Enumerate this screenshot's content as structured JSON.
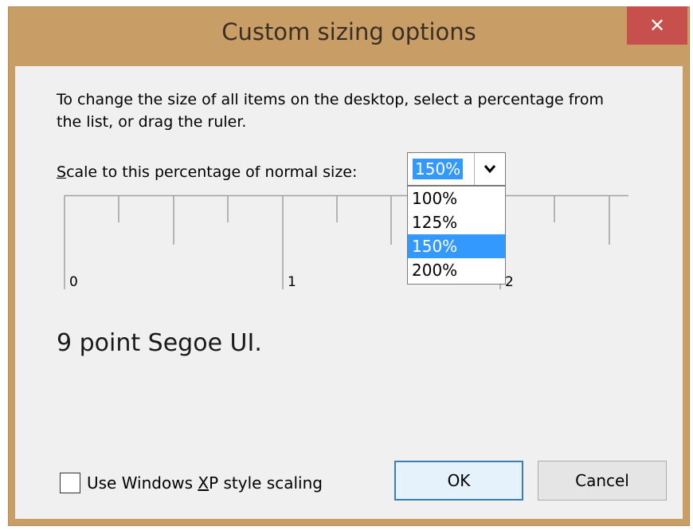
{
  "window": {
    "title": "Custom sizing options",
    "close_label": "✕"
  },
  "description": "To change the size of all items on the desktop, select a percentage from the list, or drag the ruler.",
  "scale": {
    "label_prefix": "S",
    "label_rest": "cale to this percentage of normal size:",
    "selected_value": "150%",
    "options": [
      "100%",
      "125%",
      "150%",
      "200%"
    ],
    "selected_index": 2
  },
  "ruler": {
    "labels": [
      "0",
      "1",
      "2"
    ]
  },
  "sample_text": "9 point Segoe UI.",
  "checkbox": {
    "label_before": "Use Windows ",
    "label_accel": "X",
    "label_after": "P style scaling",
    "checked": false
  },
  "buttons": {
    "ok": "OK",
    "cancel": "Cancel"
  },
  "colors": {
    "frame": "#c99e66",
    "close": "#c7504c",
    "selection": "#3399ff"
  }
}
